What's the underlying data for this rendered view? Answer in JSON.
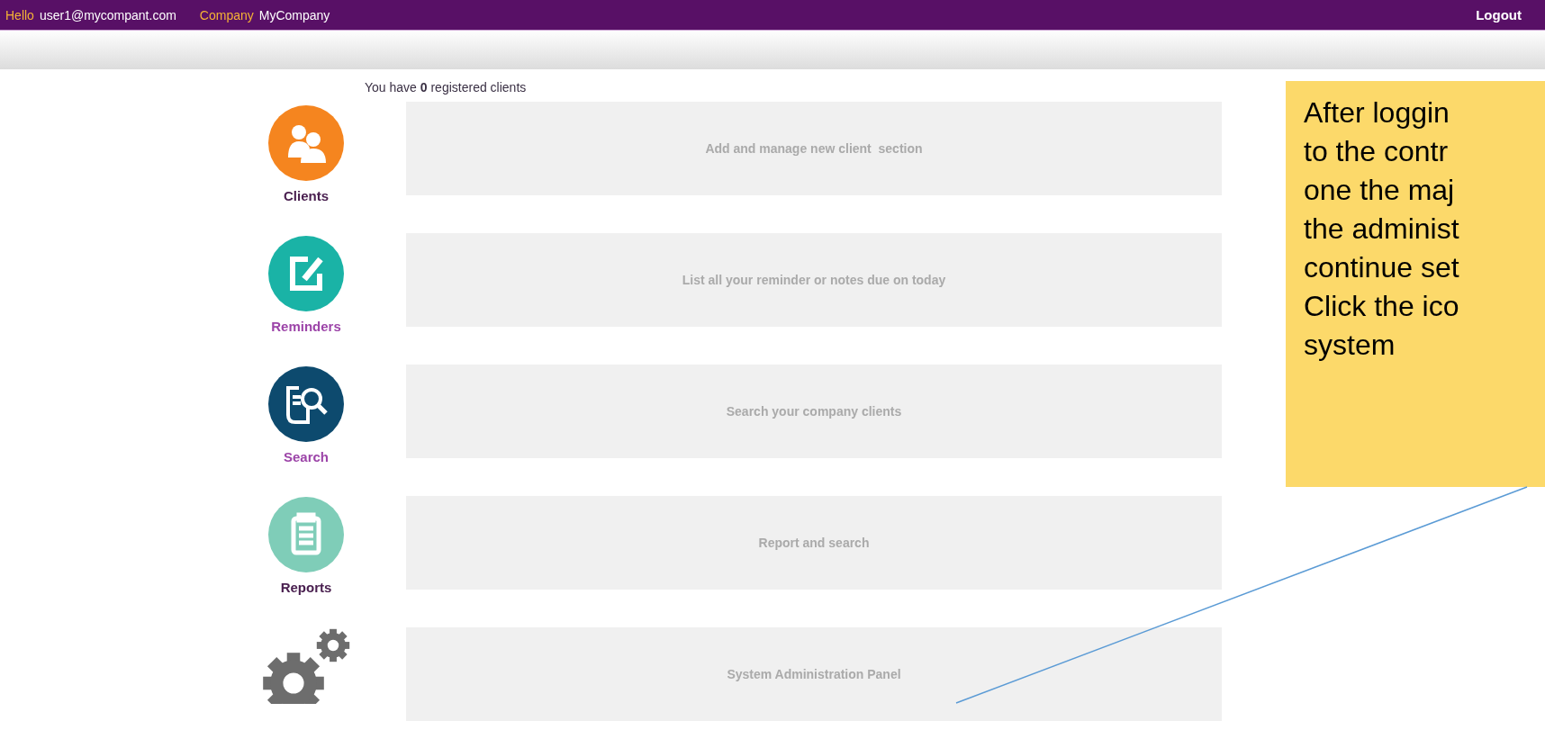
{
  "header": {
    "greeting": "Hello",
    "user": "user1@mycompant.com",
    "company_label": "Company",
    "company": "MyCompany",
    "logout": "Logout"
  },
  "summary": "You have **0** registered clients",
  "nav": [
    {
      "kind": "clients",
      "label": "Clients",
      "color": "#4a2050"
    },
    {
      "kind": "reminders",
      "label": "Reminders",
      "color": "#9c44a8"
    },
    {
      "kind": "search",
      "label": "Search",
      "color": "#9c44a8"
    },
    {
      "kind": "reports",
      "label": "Reports",
      "color": "#4a2050"
    },
    {
      "kind": "settings"
    }
  ],
  "panels": [
    "Add and manage new client  section",
    "List all your reminder or notes due on today",
    "Search your company clients",
    "Report and search",
    "System Administration Panel"
  ],
  "callout": {
    "text": "After loggin\nto the contr\none the maj\nthe administ\ncontinue set\nClick the ico\nsystem"
  }
}
